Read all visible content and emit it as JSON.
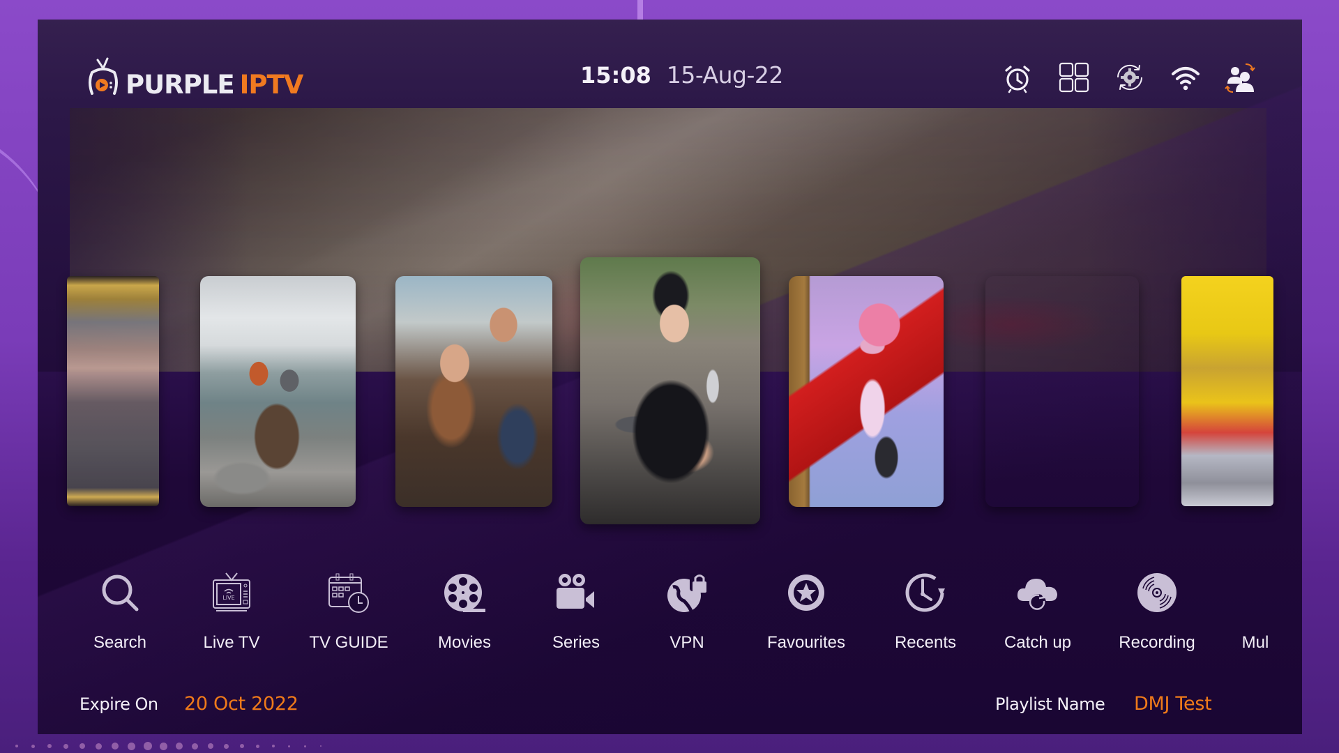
{
  "app": {
    "logo_text_primary": "PURPLE",
    "logo_text_accent": "IPTV"
  },
  "header": {
    "time": "15:08",
    "date": "15-Aug-22",
    "icons": [
      {
        "name": "alarm-clock-icon",
        "label": "Alarm"
      },
      {
        "name": "multiscreen-grid-icon",
        "label": "Multi-screen"
      },
      {
        "name": "settings-sync-icon",
        "label": "Settings"
      },
      {
        "name": "wifi-icon",
        "label": "Network"
      },
      {
        "name": "switch-user-icon",
        "label": "Switch user"
      }
    ]
  },
  "carousel": {
    "posters": [
      {
        "name": "poster-partial-left",
        "description": "pixelated poster (partially visible)"
      },
      {
        "name": "poster-hikers-clouds",
        "description": "couple sitting on a rock above clouds"
      },
      {
        "name": "poster-couple-smiling",
        "description": "smiling couple with mugs"
      },
      {
        "name": "poster-woman-guns",
        "description": "woman holding two pistols",
        "focused": true
      },
      {
        "name": "poster-animated-girl-slide",
        "description": "animated girl with pink hair on a red slide"
      },
      {
        "name": "poster-man-headphones",
        "description": "man with headphones in city at night"
      },
      {
        "name": "poster-partial-right",
        "description": "pixelated poster (partially visible)"
      }
    ]
  },
  "menu": {
    "items": [
      {
        "label": "Search",
        "icon": "search-icon"
      },
      {
        "label": "Live TV",
        "icon": "live-tv-icon"
      },
      {
        "label": "TV GUIDE",
        "icon": "tv-guide-calendar-icon"
      },
      {
        "label": "Movies",
        "icon": "film-reel-icon"
      },
      {
        "label": "Series",
        "icon": "video-camera-icon"
      },
      {
        "label": "VPN",
        "icon": "vpn-globe-lock-icon"
      },
      {
        "label": "Favourites",
        "icon": "star-circle-icon"
      },
      {
        "label": "Recents",
        "icon": "history-clock-icon"
      },
      {
        "label": "Catch up",
        "icon": "cloud-replay-icon"
      },
      {
        "label": "Recording",
        "icon": "vinyl-record-icon"
      },
      {
        "label": "Mul",
        "icon": ""
      }
    ]
  },
  "footer": {
    "expire_label": "Expire On",
    "expire_value": "20 Oct 2022",
    "playlist_label": "Playlist Name",
    "playlist_value": "DMJ Test"
  },
  "colors": {
    "accent_orange": "#ef7a1a",
    "outer_purple": "#8b4ac9",
    "panel_dark": "#1a0633",
    "icon_gray": "#c9bfd6"
  }
}
